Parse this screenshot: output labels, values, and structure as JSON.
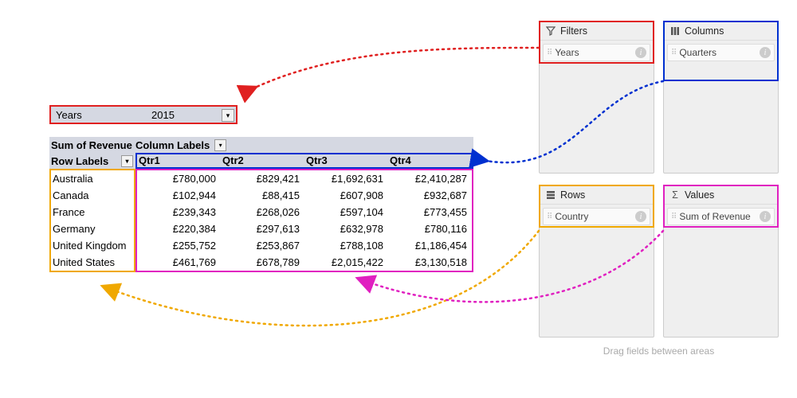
{
  "filter_bar": {
    "field_label": "Years",
    "value": "2015"
  },
  "pivot": {
    "sum_of_revenue_label": "Sum of Revenue",
    "column_labels_label": "Column Labels",
    "row_labels_label": "Row Labels",
    "quarters": [
      "Qtr1",
      "Qtr2",
      "Qtr3",
      "Qtr4"
    ],
    "rows": [
      {
        "country": "Australia",
        "values": [
          "£780,000",
          "£829,421",
          "£1,692,631",
          "£2,410,287"
        ]
      },
      {
        "country": "Canada",
        "values": [
          "£102,944",
          "£88,415",
          "£607,908",
          "£932,687"
        ]
      },
      {
        "country": "France",
        "values": [
          "£239,343",
          "£268,026",
          "£597,104",
          "£773,455"
        ]
      },
      {
        "country": "Germany",
        "values": [
          "£220,384",
          "£297,613",
          "£632,978",
          "£780,116"
        ]
      },
      {
        "country": "United Kingdom",
        "values": [
          "£255,752",
          "£253,867",
          "£788,108",
          "£1,186,454"
        ]
      },
      {
        "country": "United States",
        "values": [
          "£461,769",
          "£678,789",
          "£2,015,422",
          "£3,130,518"
        ]
      }
    ]
  },
  "areas": {
    "filters": {
      "title": "Filters",
      "items": [
        "Years"
      ]
    },
    "columns": {
      "title": "Columns",
      "items": [
        "Quarters"
      ]
    },
    "rows": {
      "title": "Rows",
      "items": [
        "Country"
      ]
    },
    "values": {
      "title": "Values",
      "items": [
        "Sum of Revenue"
      ]
    }
  },
  "drag_hint": "Drag fields between areas",
  "colors": {
    "filters": "#e02020",
    "columns": "#0030d0",
    "rows": "#f0a800",
    "values": "#e020c0"
  }
}
